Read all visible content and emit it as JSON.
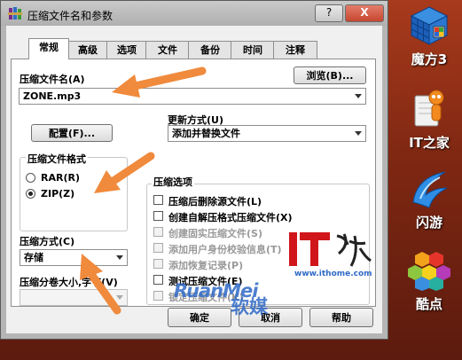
{
  "window": {
    "title": "压缩文件名和参数",
    "help_label": "?",
    "close_label": "X"
  },
  "tabs": [
    {
      "label": "常规",
      "active": true
    },
    {
      "label": "高级",
      "active": false
    },
    {
      "label": "选项",
      "active": false
    },
    {
      "label": "文件",
      "active": false
    },
    {
      "label": "备份",
      "active": false
    },
    {
      "label": "时间",
      "active": false
    },
    {
      "label": "注释",
      "active": false
    }
  ],
  "general": {
    "archive_name_label": "压缩文件名(A)",
    "browse_label": "浏览(B)...",
    "archive_name_value": "ZONE.mp3",
    "profiles_label": "配置(F)...",
    "update_mode_label": "更新方式(U)",
    "update_mode_value": "添加并替换文件",
    "format_group_label": "压缩文件格式",
    "format_options": [
      {
        "label": "RAR(R)",
        "selected": false
      },
      {
        "label": "ZIP(Z)",
        "selected": true
      }
    ],
    "method_label": "压缩方式(C)",
    "method_value": "存储",
    "split_label": "压缩分卷大小,字节(V)",
    "split_value": "",
    "options_group_label": "压缩选项",
    "options": [
      {
        "label": "压缩后删除源文件(L)",
        "checked": false,
        "enabled": true
      },
      {
        "label": "创建自解压格式压缩文件(X)",
        "checked": false,
        "enabled": true
      },
      {
        "label": "创建固实压缩文件(S)",
        "checked": false,
        "enabled": false
      },
      {
        "label": "添加用户身份校验信息(T)",
        "checked": false,
        "enabled": false
      },
      {
        "label": "添加恢复记录(P)",
        "checked": false,
        "enabled": false
      },
      {
        "label": "测试压缩文件(E)",
        "checked": false,
        "enabled": true
      },
      {
        "label": "锁定压缩文件(K)",
        "checked": false,
        "enabled": false
      }
    ]
  },
  "footer": {
    "ok_label": "确定",
    "cancel_label": "取消",
    "help_label": "帮助"
  },
  "desktop_icons": [
    {
      "label": "魔方3",
      "icon": "mofang-cube-icon"
    },
    {
      "label": "IT之家",
      "icon": "ithome-mascot-icon"
    },
    {
      "label": "闪游",
      "icon": "flash-swirl-icon"
    },
    {
      "label": "酷点",
      "icon": "hexagon-cluster-icon"
    }
  ],
  "watermarks": {
    "it_logo": "IT之家",
    "url": "www.ithome.com",
    "ruanmei_en": "RuanMei",
    "ruanmei_cn": "软媒"
  },
  "colors": {
    "desktop": "#8a2c14",
    "annotation_arrow": "#f08a3c",
    "watermark_blue": "#2f69c6",
    "watermark_red": "#d0161b"
  }
}
